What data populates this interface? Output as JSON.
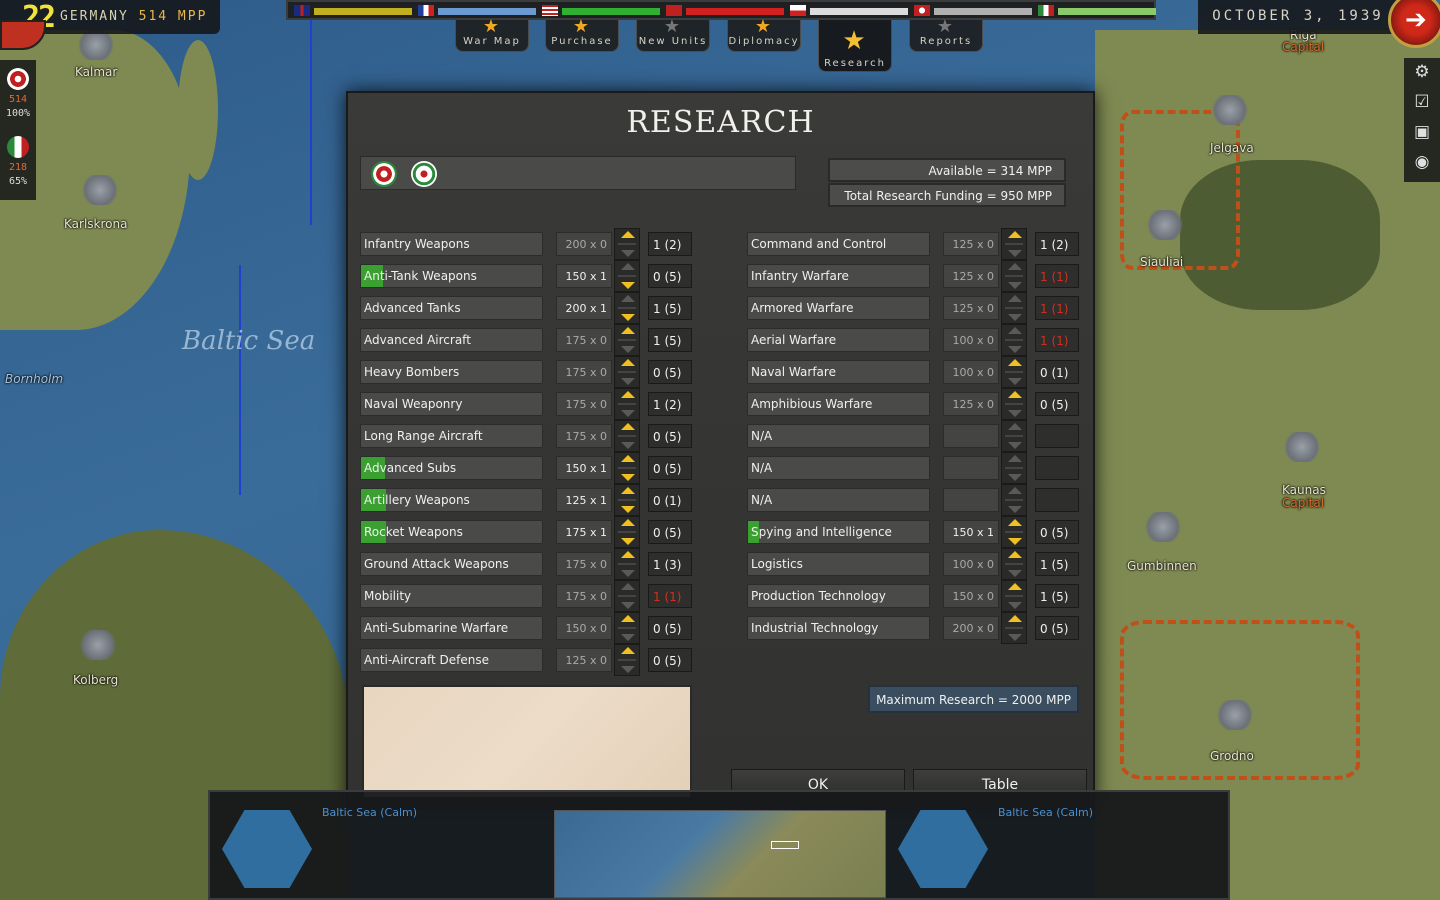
{
  "header": {
    "turn": "22",
    "country": "GERMANY",
    "mpp": "514 MPP",
    "date": "OCTOBER 3, 1939"
  },
  "side_stats": [
    {
      "value": "514",
      "pct": "100%"
    },
    {
      "value": "218",
      "pct": "65%"
    }
  ],
  "tabs": [
    {
      "label": "War Map"
    },
    {
      "label": "Purchase"
    },
    {
      "label": "New Units"
    },
    {
      "label": "Diplomacy"
    },
    {
      "label": "Research"
    },
    {
      "label": "Reports"
    }
  ],
  "map": {
    "sea_label": "Baltic Sea",
    "cities": [
      "Kalmar",
      "Karlskrona",
      "Bornholm",
      "Kolberg",
      "Riga",
      "Jelgava",
      "Siauliai",
      "Kaunas",
      "Gumbinnen",
      "Grodno"
    ],
    "capital_label": "Capital"
  },
  "dialog": {
    "title": "RESEARCH",
    "available_label": "Available =",
    "available_value": "314 MPP",
    "total_label": "Total Research Funding =",
    "total_value": "950 MPP",
    "max_label": "Maximum Research =",
    "max_value": "2000 MPP",
    "ok_label": "OK",
    "table_label": "Table"
  },
  "left_techs": [
    {
      "name": "Infantry Weapons",
      "cost": "200 x 0",
      "level": "1 (2)",
      "invested": false,
      "progress": 0,
      "can_up": true,
      "can_down": false,
      "red": false
    },
    {
      "name": "Anti-Tank Weapons",
      "cost": "150 x 1",
      "level": "0 (5)",
      "invested": true,
      "progress": 0.12,
      "can_up": false,
      "can_down": true,
      "red": false
    },
    {
      "name": "Advanced Tanks",
      "cost": "200 x 1",
      "level": "1 (5)",
      "invested": true,
      "progress": 0,
      "can_up": false,
      "can_down": true,
      "red": false
    },
    {
      "name": "Advanced Aircraft",
      "cost": "175 x 0",
      "level": "1 (5)",
      "invested": false,
      "progress": 0,
      "can_up": true,
      "can_down": false,
      "red": false
    },
    {
      "name": "Heavy Bombers",
      "cost": "175 x 0",
      "level": "0 (5)",
      "invested": false,
      "progress": 0,
      "can_up": true,
      "can_down": false,
      "red": false
    },
    {
      "name": "Naval Weaponry",
      "cost": "175 x 0",
      "level": "1 (2)",
      "invested": false,
      "progress": 0,
      "can_up": true,
      "can_down": false,
      "red": false
    },
    {
      "name": "Long Range Aircraft",
      "cost": "175 x 0",
      "level": "0 (5)",
      "invested": false,
      "progress": 0,
      "can_up": true,
      "can_down": false,
      "red": false
    },
    {
      "name": "Advanced Subs",
      "cost": "150 x 1",
      "level": "0 (5)",
      "invested": true,
      "progress": 0.13,
      "can_up": true,
      "can_down": true,
      "red": false
    },
    {
      "name": "Artillery Weapons",
      "cost": "125 x 1",
      "level": "0 (1)",
      "invested": true,
      "progress": 0.14,
      "can_up": true,
      "can_down": true,
      "red": false
    },
    {
      "name": "Rocket Weapons",
      "cost": "175 x 1",
      "level": "0 (5)",
      "invested": true,
      "progress": 0.14,
      "can_up": true,
      "can_down": true,
      "red": false
    },
    {
      "name": "Ground Attack Weapons",
      "cost": "175 x 0",
      "level": "1 (3)",
      "invested": false,
      "progress": 0,
      "can_up": true,
      "can_down": false,
      "red": false
    },
    {
      "name": "Mobility",
      "cost": "175 x 0",
      "level": "1 (1)",
      "invested": false,
      "progress": 0,
      "can_up": false,
      "can_down": false,
      "red": true
    },
    {
      "name": "Anti-Submarine Warfare",
      "cost": "150 x 0",
      "level": "0 (5)",
      "invested": false,
      "progress": 0,
      "can_up": true,
      "can_down": false,
      "red": false
    },
    {
      "name": "Anti-Aircraft Defense",
      "cost": "125 x 0",
      "level": "0 (5)",
      "invested": false,
      "progress": 0,
      "can_up": true,
      "can_down": false,
      "red": false
    }
  ],
  "right_techs": [
    {
      "name": "Command and Control",
      "cost": "125 x 0",
      "level": "1 (2)",
      "invested": false,
      "progress": 0,
      "can_up": true,
      "can_down": false,
      "red": false
    },
    {
      "name": "Infantry Warfare",
      "cost": "125 x 0",
      "level": "1 (1)",
      "invested": false,
      "progress": 0,
      "can_up": false,
      "can_down": false,
      "red": true
    },
    {
      "name": "Armored Warfare",
      "cost": "125 x 0",
      "level": "1 (1)",
      "invested": false,
      "progress": 0,
      "can_up": false,
      "can_down": false,
      "red": true
    },
    {
      "name": "Aerial Warfare",
      "cost": "100 x 0",
      "level": "1 (1)",
      "invested": false,
      "progress": 0,
      "can_up": false,
      "can_down": false,
      "red": true
    },
    {
      "name": "Naval Warfare",
      "cost": "100 x 0",
      "level": "0 (1)",
      "invested": false,
      "progress": 0,
      "can_up": true,
      "can_down": false,
      "red": false
    },
    {
      "name": "Amphibious Warfare",
      "cost": "125 x 0",
      "level": "0 (5)",
      "invested": false,
      "progress": 0,
      "can_up": true,
      "can_down": false,
      "red": false
    },
    {
      "name": "N/A",
      "cost": "",
      "level": "",
      "invested": false,
      "progress": 0,
      "can_up": false,
      "can_down": false,
      "red": false
    },
    {
      "name": "N/A",
      "cost": "",
      "level": "",
      "invested": false,
      "progress": 0,
      "can_up": false,
      "can_down": false,
      "red": false
    },
    {
      "name": "N/A",
      "cost": "",
      "level": "",
      "invested": false,
      "progress": 0,
      "can_up": false,
      "can_down": false,
      "red": false
    },
    {
      "name": "Spying and Intelligence",
      "cost": "150 x 1",
      "level": "0 (5)",
      "invested": true,
      "progress": 0.06,
      "can_up": true,
      "can_down": true,
      "red": false
    },
    {
      "name": "Logistics",
      "cost": "100 x 0",
      "level": "1 (5)",
      "invested": false,
      "progress": 0,
      "can_up": true,
      "can_down": false,
      "red": false
    },
    {
      "name": "Production Technology",
      "cost": "150 x 0",
      "level": "1 (5)",
      "invested": false,
      "progress": 0,
      "can_up": true,
      "can_down": false,
      "red": false
    },
    {
      "name": "Industrial Technology",
      "cost": "200 x 0",
      "level": "0 (5)",
      "invested": false,
      "progress": 0,
      "can_up": true,
      "can_down": false,
      "red": false
    }
  ],
  "bottom": {
    "left_terrain": "Baltic Sea (Calm)",
    "right_terrain": "Baltic Sea (Calm)"
  },
  "colors": {
    "accent_gold": "#f0c020",
    "invest_green": "#3aa030",
    "maxed_red": "#d03020"
  }
}
